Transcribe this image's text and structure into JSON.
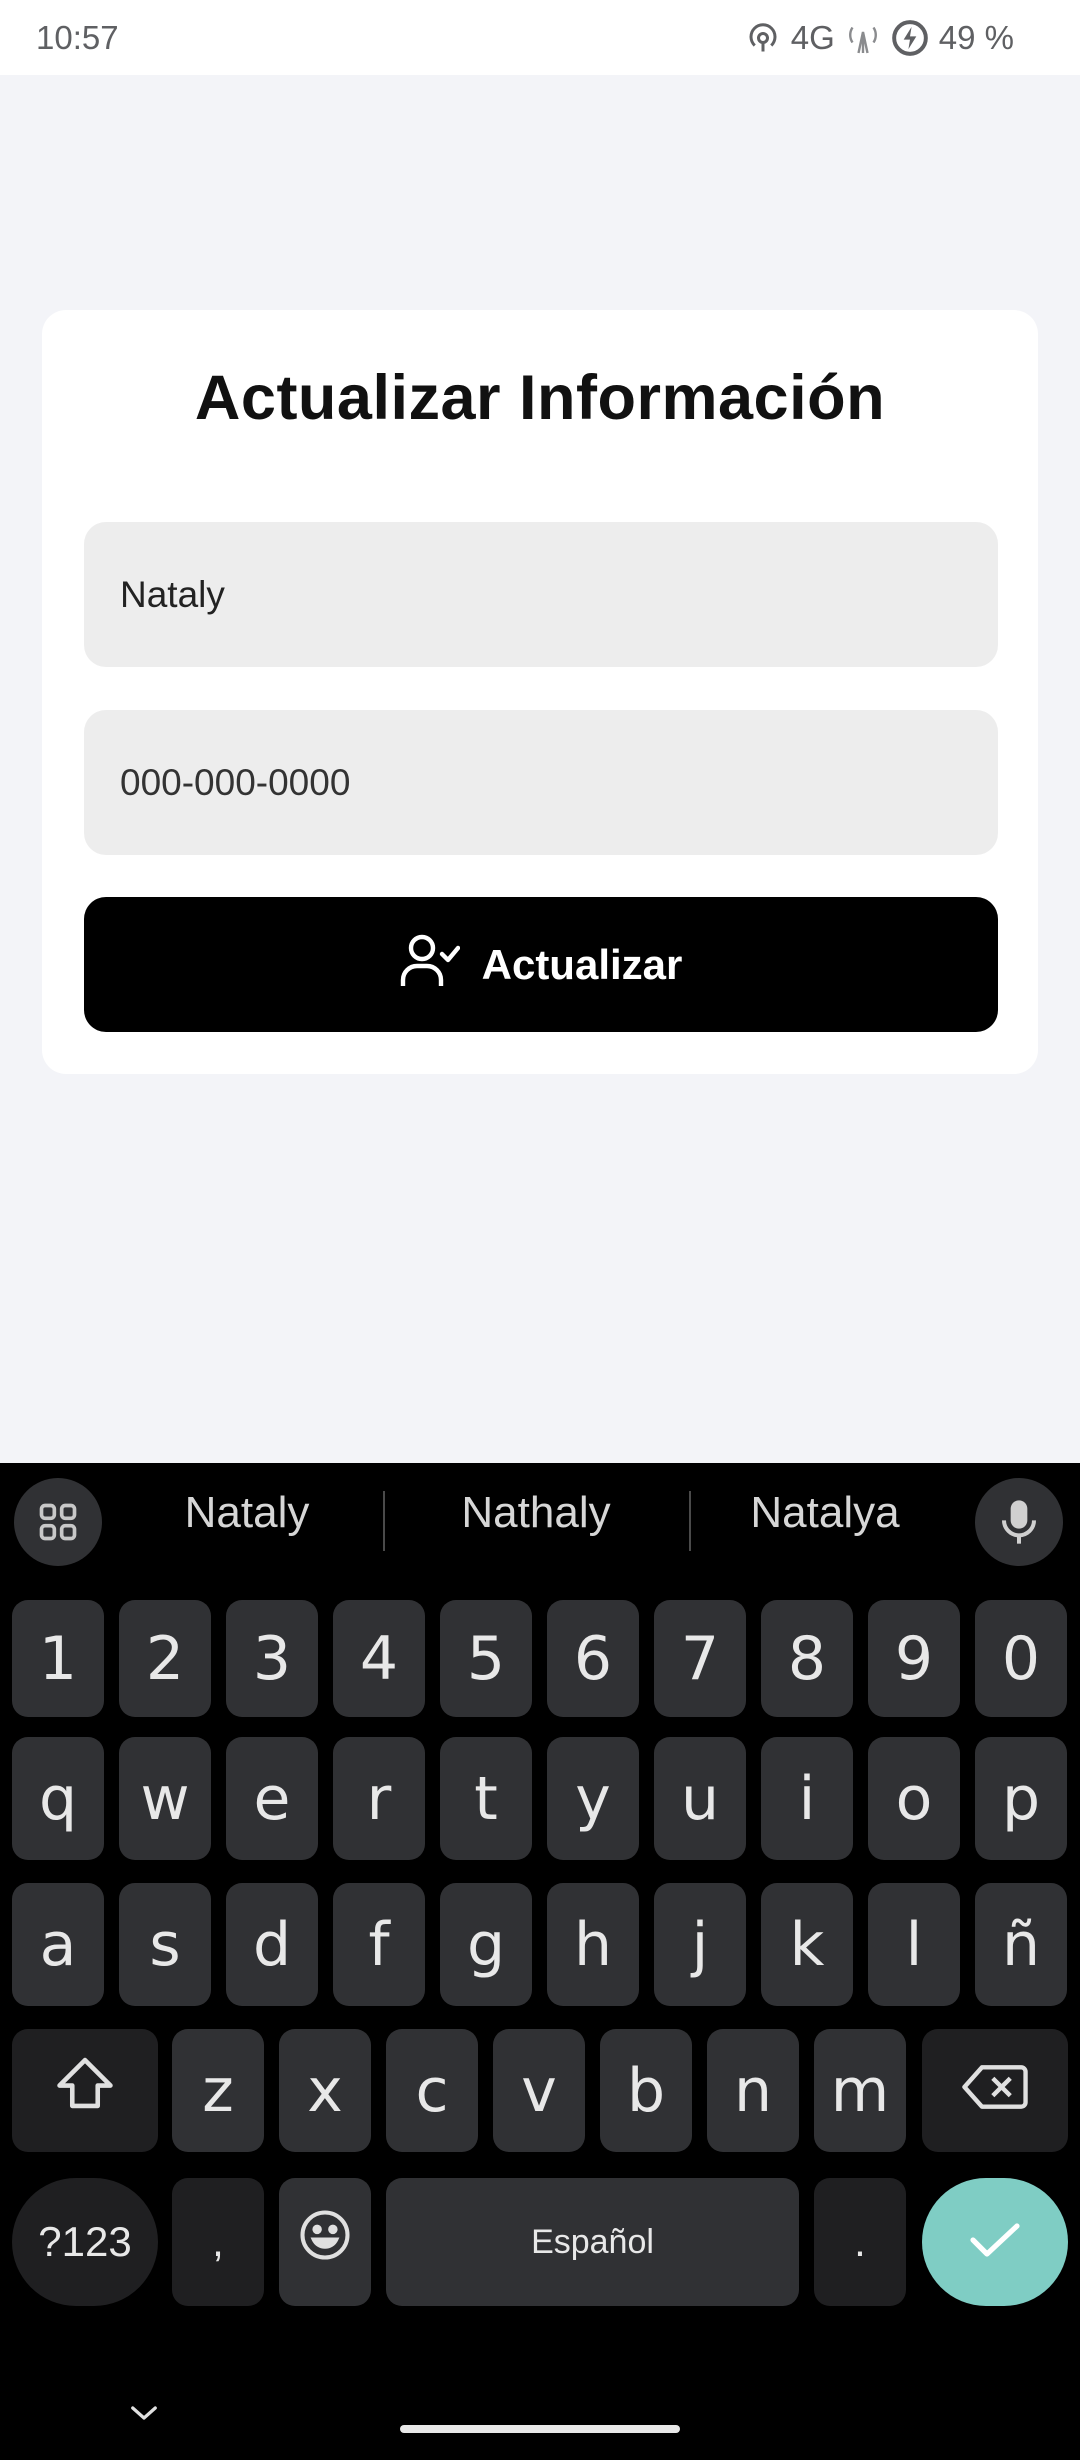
{
  "status_bar": {
    "time": "10:57",
    "network": "4G",
    "battery": "49 %"
  },
  "form": {
    "title": "Actualizar Información",
    "name_value": "Nataly",
    "phone_placeholder": "000-000-0000",
    "submit_label": "Actualizar"
  },
  "keyboard": {
    "suggestions": [
      "Nataly",
      "Nathaly",
      "Natalya"
    ],
    "number_row": [
      "1",
      "2",
      "3",
      "4",
      "5",
      "6",
      "7",
      "8",
      "9",
      "0"
    ],
    "row1": [
      "q",
      "w",
      "e",
      "r",
      "t",
      "y",
      "u",
      "i",
      "o",
      "p"
    ],
    "row2": [
      "a",
      "s",
      "d",
      "f",
      "g",
      "h",
      "j",
      "k",
      "l",
      "ñ"
    ],
    "row3": [
      "z",
      "x",
      "c",
      "v",
      "b",
      "n",
      "m"
    ],
    "symbols_label": "?123",
    "comma": ",",
    "period": ".",
    "space_label": "Español"
  }
}
